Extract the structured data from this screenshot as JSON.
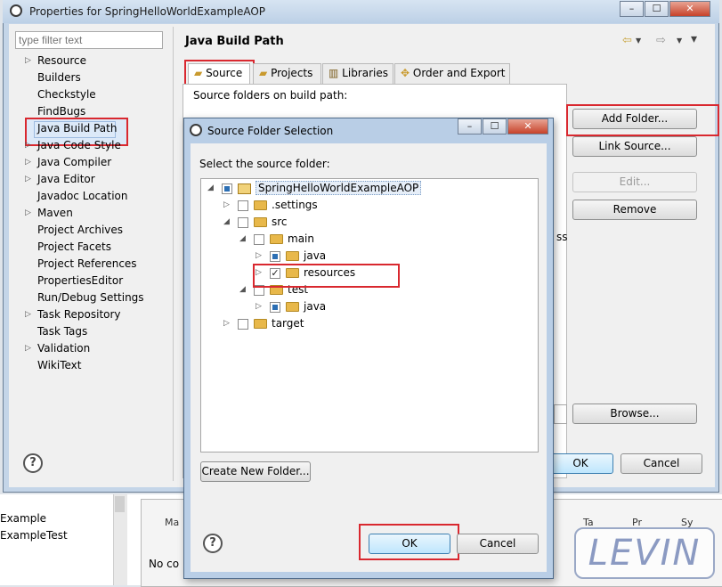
{
  "workbench": {
    "left_items": [
      "Example",
      "ExampleTest"
    ],
    "bottom_tabs": [
      "Ma",
      "Ta",
      "Pr",
      "Sy"
    ],
    "status_text": "No co"
  },
  "window": {
    "title": "Properties for SpringHelloWorldExampleAOP",
    "minimize": "–",
    "maximize": "☐",
    "close": "✕"
  },
  "filter": {
    "placeholder": "type filter text"
  },
  "nav": {
    "items": [
      {
        "label": "Resource",
        "expandable": true
      },
      {
        "label": "Builders",
        "expandable": false
      },
      {
        "label": "Checkstyle",
        "expandable": false
      },
      {
        "label": "FindBugs",
        "expandable": false
      },
      {
        "label": "Java Build Path",
        "expandable": false,
        "selected": true
      },
      {
        "label": "Java Code Style",
        "expandable": true
      },
      {
        "label": "Java Compiler",
        "expandable": true
      },
      {
        "label": "Java Editor",
        "expandable": true
      },
      {
        "label": "Javadoc Location",
        "expandable": false
      },
      {
        "label": "Maven",
        "expandable": true
      },
      {
        "label": "Project Archives",
        "expandable": false
      },
      {
        "label": "Project Facets",
        "expandable": false
      },
      {
        "label": "Project References",
        "expandable": false
      },
      {
        "label": "PropertiesEditor",
        "expandable": false
      },
      {
        "label": "Run/Debug Settings",
        "expandable": false
      },
      {
        "label": "Task Repository",
        "expandable": true
      },
      {
        "label": "Task Tags",
        "expandable": false
      },
      {
        "label": "Validation",
        "expandable": true
      },
      {
        "label": "WikiText",
        "expandable": false
      }
    ]
  },
  "page": {
    "title": "Java Build Path",
    "tabs": [
      "Source",
      "Projects",
      "Libraries",
      "Order and Export"
    ],
    "source_label": "Source folders on build path:",
    "buttons": {
      "add_folder": "Add Folder...",
      "link_source": "Link Source...",
      "edit": "Edit...",
      "remove": "Remove",
      "browse": "Browse..."
    },
    "ok": "OK",
    "cancel": "Cancel",
    "partial_text": "ss"
  },
  "dialog": {
    "title": "Source Folder Selection",
    "prompt": "Select the source folder:",
    "tree": [
      {
        "label": "SpringHelloWorldExampleAOP",
        "level": 0,
        "toggle": "open",
        "check": "partial",
        "icon": "project"
      },
      {
        "label": ".settings",
        "level": 1,
        "toggle": "closed",
        "check": "none",
        "icon": "folder"
      },
      {
        "label": "src",
        "level": 1,
        "toggle": "open",
        "check": "none",
        "icon": "folder"
      },
      {
        "label": "main",
        "level": 2,
        "toggle": "open",
        "check": "none",
        "icon": "folder"
      },
      {
        "label": "java",
        "level": 3,
        "toggle": "closed",
        "check": "partial",
        "icon": "folder"
      },
      {
        "label": "resources",
        "level": 3,
        "toggle": "closed",
        "check": "checked",
        "icon": "folder"
      },
      {
        "label": "test",
        "level": 2,
        "toggle": "open",
        "check": "none",
        "icon": "folder"
      },
      {
        "label": "java",
        "level": 3,
        "toggle": "closed",
        "check": "partial",
        "icon": "folder"
      },
      {
        "label": "target",
        "level": 1,
        "toggle": "closed",
        "check": "none",
        "icon": "folder"
      }
    ],
    "create_folder": "Create New Folder...",
    "ok": "OK",
    "cancel": "Cancel"
  },
  "watermark": "LEVIN",
  "colors": {
    "highlight_red": "#d9282f",
    "title_bar": "#c4d5e8",
    "selection": "#dce9f8"
  }
}
